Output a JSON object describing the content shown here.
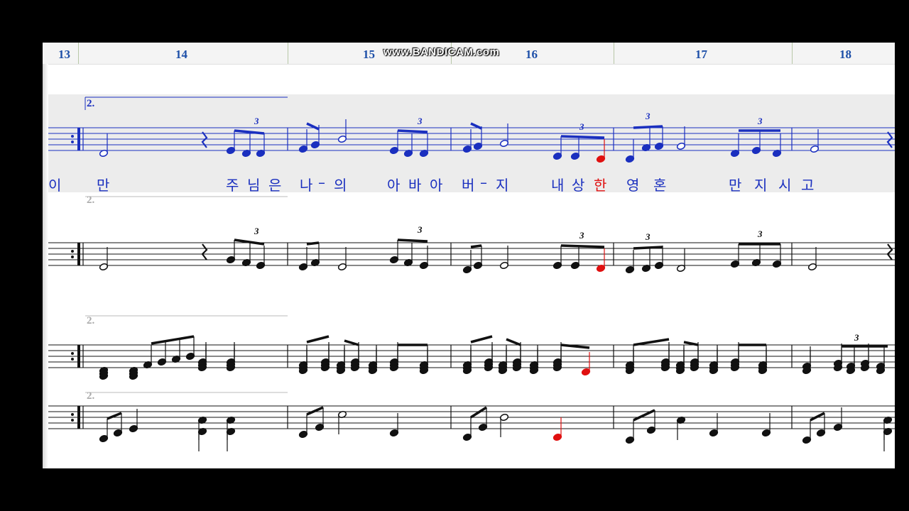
{
  "watermark": "www.BANDICAM.com",
  "measure_numbers": [
    "13",
    "14",
    "15",
    "16",
    "17",
    "18"
  ],
  "volta_label": "2.",
  "triplet_label": "3",
  "lyrics": [
    "이",
    "만",
    "주",
    "님",
    "은",
    "나",
    "–",
    "의",
    "아",
    "바",
    "아",
    "버",
    "–",
    "지",
    "내",
    "상",
    "한",
    "영",
    "혼",
    "만",
    "지",
    "시",
    "고"
  ],
  "colors": {
    "active_staff": "#1a2fbf",
    "highlight_note": "#e01010",
    "measure_number": "#1d4fa8"
  }
}
